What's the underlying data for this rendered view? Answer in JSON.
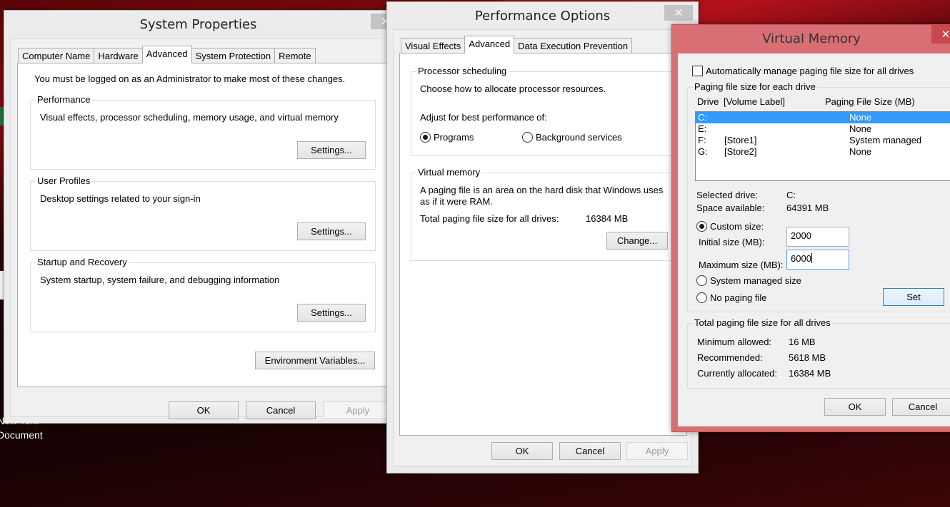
{
  "desktop": {
    "icon_label_line1": "New Text",
    "icon_label_line2": "Document"
  },
  "system_properties": {
    "title": "System Properties",
    "close_glyph": "✕",
    "tabs": [
      {
        "label": "Computer Name",
        "active": false
      },
      {
        "label": "Hardware",
        "active": false
      },
      {
        "label": "Advanced",
        "active": true
      },
      {
        "label": "System Protection",
        "active": false
      },
      {
        "label": "Remote",
        "active": false
      }
    ],
    "admin_notice": "You must be logged on as an Administrator to make most of these changes.",
    "groups": {
      "performance": {
        "label": "Performance",
        "description": "Visual effects, processor scheduling, memory usage, and virtual memory",
        "button": "Settings..."
      },
      "user_profiles": {
        "label": "User Profiles",
        "description": "Desktop settings related to your sign-in",
        "button": "Settings..."
      },
      "startup_recovery": {
        "label": "Startup and Recovery",
        "description": "System startup, system failure, and debugging information",
        "button": "Settings..."
      }
    },
    "env_vars_button": "Environment Variables...",
    "buttons": {
      "ok": "OK",
      "cancel": "Cancel",
      "apply": "Apply"
    }
  },
  "performance_options": {
    "title": "Performance Options",
    "close_glyph": "✕",
    "tabs": [
      {
        "label": "Visual Effects",
        "active": false
      },
      {
        "label": "Advanced",
        "active": true
      },
      {
        "label": "Data Execution Prevention",
        "active": false
      }
    ],
    "processor_scheduling": {
      "label": "Processor scheduling",
      "description": "Choose how to allocate processor resources.",
      "adjust_label": "Adjust for best performance of:",
      "options": [
        {
          "label": "Programs",
          "checked": true
        },
        {
          "label": "Background services",
          "checked": false
        }
      ]
    },
    "virtual_memory": {
      "label": "Virtual memory",
      "description_line1": "A paging file is an area on the hard disk that Windows uses",
      "description_line2": "as if it were RAM.",
      "total_label": "Total paging file size for all drives:",
      "total_value": "16384 MB",
      "change_button": "Change..."
    },
    "buttons": {
      "ok": "OK",
      "cancel": "Cancel",
      "apply": "Apply"
    }
  },
  "virtual_memory": {
    "title": "Virtual Memory",
    "close_glyph": "✕",
    "auto_manage_label": "Automatically manage paging file size for all drives",
    "auto_manage_checked": false,
    "per_drive_group_label": "Paging file size for each drive",
    "columns": {
      "drive": "Drive",
      "volume_label": "[Volume Label]",
      "paging_size": "Paging File Size (MB)"
    },
    "drives": [
      {
        "drive": "C:",
        "label": "",
        "size": "None",
        "selected": true
      },
      {
        "drive": "E:",
        "label": "",
        "size": "None",
        "selected": false
      },
      {
        "drive": "F:",
        "label": "[Store1]",
        "size": "System managed",
        "selected": false
      },
      {
        "drive": "G:",
        "label": "[Store2]",
        "size": "None",
        "selected": false
      }
    ],
    "selected_drive_label": "Selected drive:",
    "selected_drive_value": "C:",
    "space_available_label": "Space available:",
    "space_available_value": "64391 MB",
    "custom_size_label": "Custom size:",
    "custom_size_checked": true,
    "initial_size_label": "Initial size (MB):",
    "initial_size_value": "2000",
    "maximum_size_label": "Maximum size (MB):",
    "maximum_size_value": "6000",
    "system_managed_label": "System managed size",
    "no_paging_label": "No paging file",
    "set_button": "Set",
    "totals_group_label": "Total paging file size for all drives",
    "minimum_allowed_label": "Minimum allowed:",
    "minimum_allowed_value": "16 MB",
    "recommended_label": "Recommended:",
    "recommended_value": "5618 MB",
    "currently_allocated_label": "Currently allocated:",
    "currently_allocated_value": "16384 MB",
    "buttons": {
      "ok": "OK",
      "cancel": "Cancel"
    }
  }
}
